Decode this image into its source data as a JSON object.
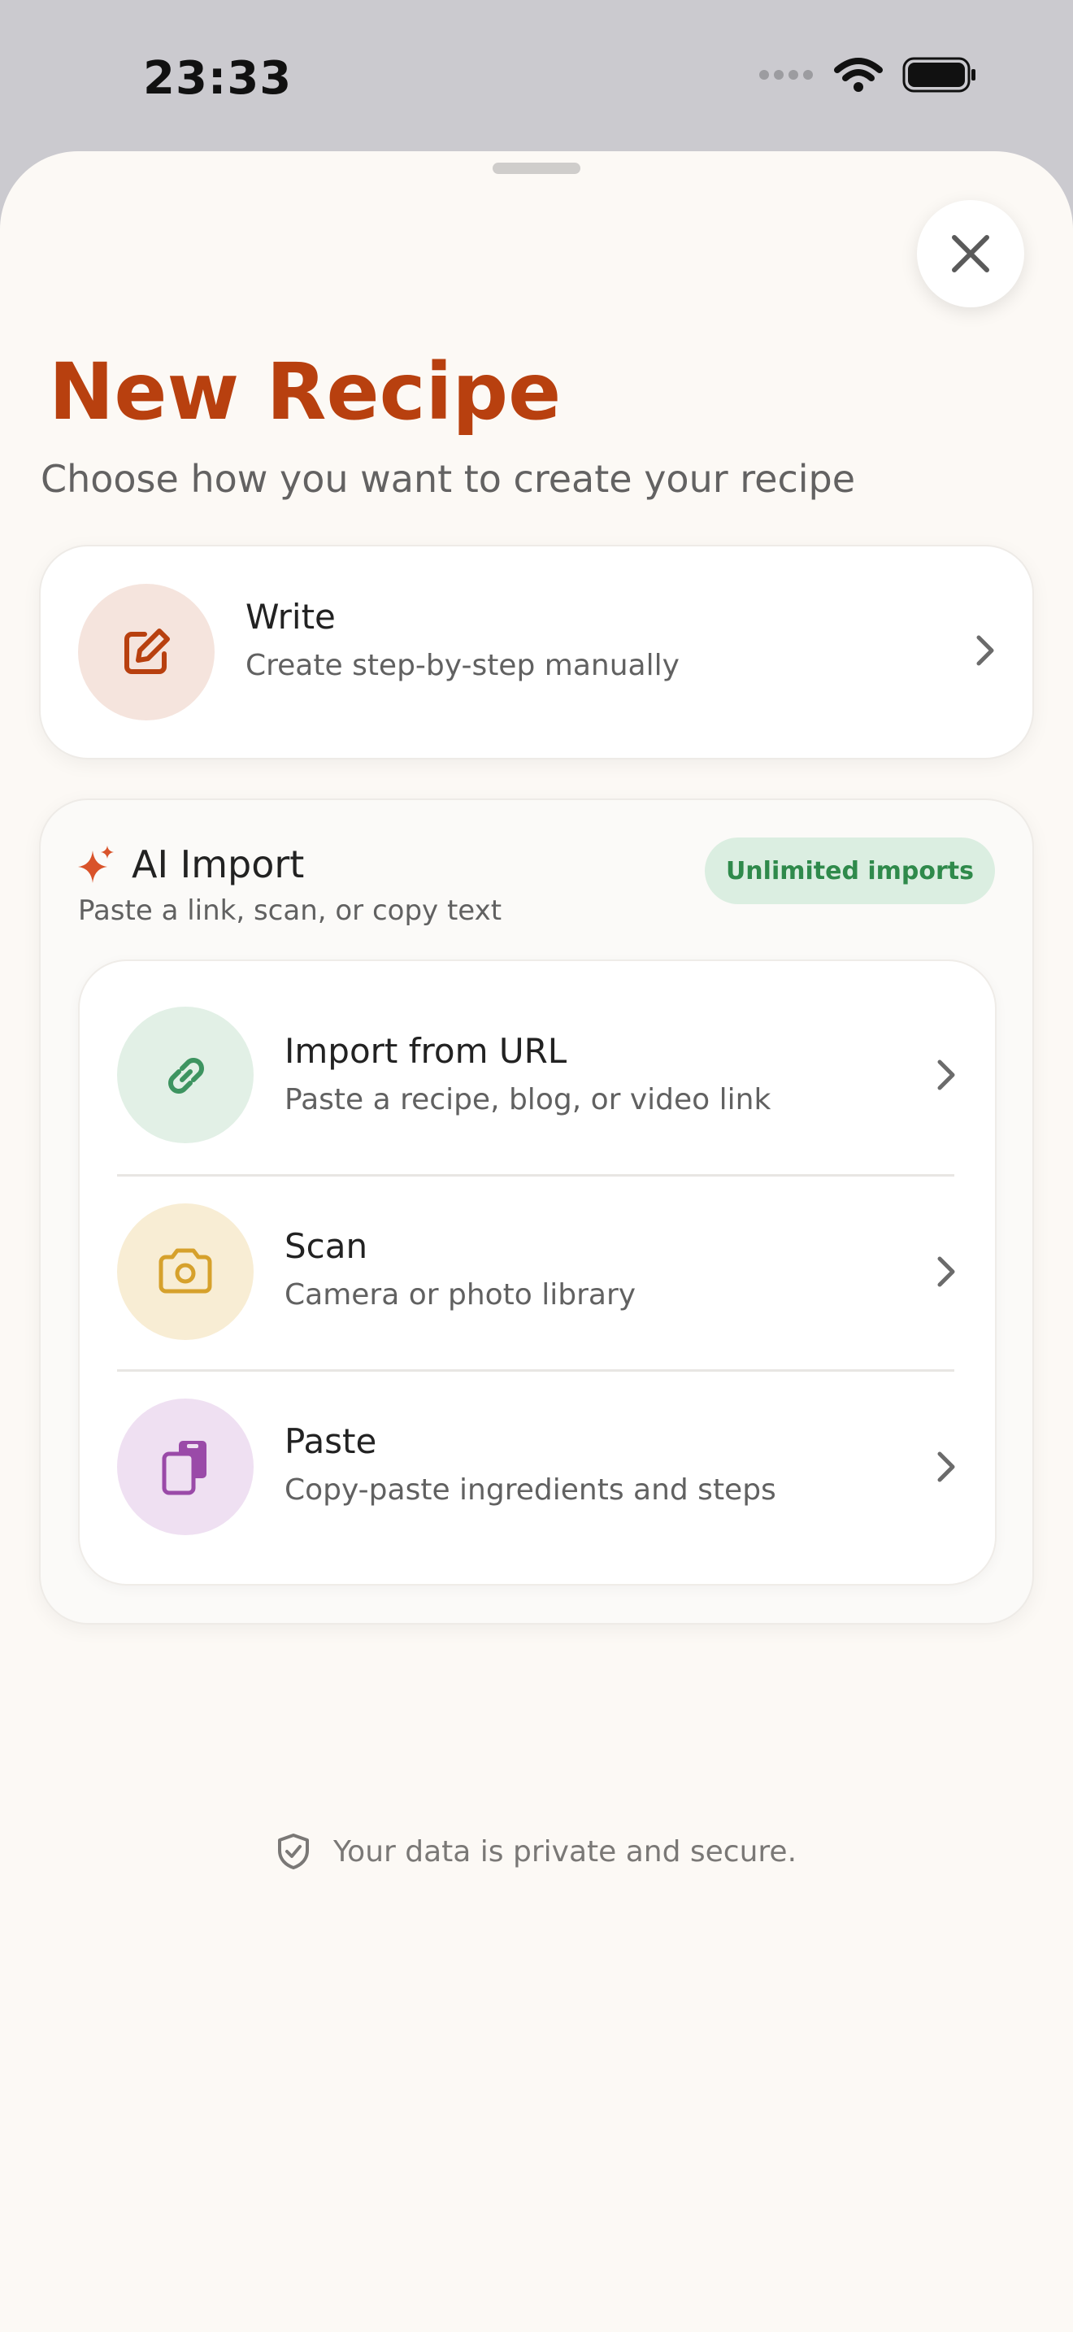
{
  "status_bar": {
    "time": "23:33"
  },
  "header": {
    "title": "New Recipe",
    "subtitle": "Choose how you want to create your recipe"
  },
  "write_option": {
    "title": "Write",
    "subtitle": "Create step-by-step manually",
    "icon": "pencil-square-icon"
  },
  "ai_import": {
    "heading": "AI Import",
    "subheading": "Paste a link, scan, or copy text",
    "badge": "Unlimited imports",
    "options": [
      {
        "title": "Import from URL",
        "subtitle": "Paste a recipe, blog, or video link",
        "icon": "link-icon"
      },
      {
        "title": "Scan",
        "subtitle": "Camera or photo library",
        "icon": "camera-icon"
      },
      {
        "title": "Paste",
        "subtitle": "Copy-paste ingredients and steps",
        "icon": "clipboard-icon"
      }
    ]
  },
  "footer": {
    "privacy_note": "Your data is private and secure."
  },
  "colors": {
    "accent": "#b8400f",
    "sheet_background": "#fcf9f5",
    "badge_background": "#dbeee1",
    "badge_text": "#2f8a4b",
    "url_icon": "#3d9460",
    "scan_icon": "#d6a12c",
    "paste_icon": "#9a4aa8"
  }
}
